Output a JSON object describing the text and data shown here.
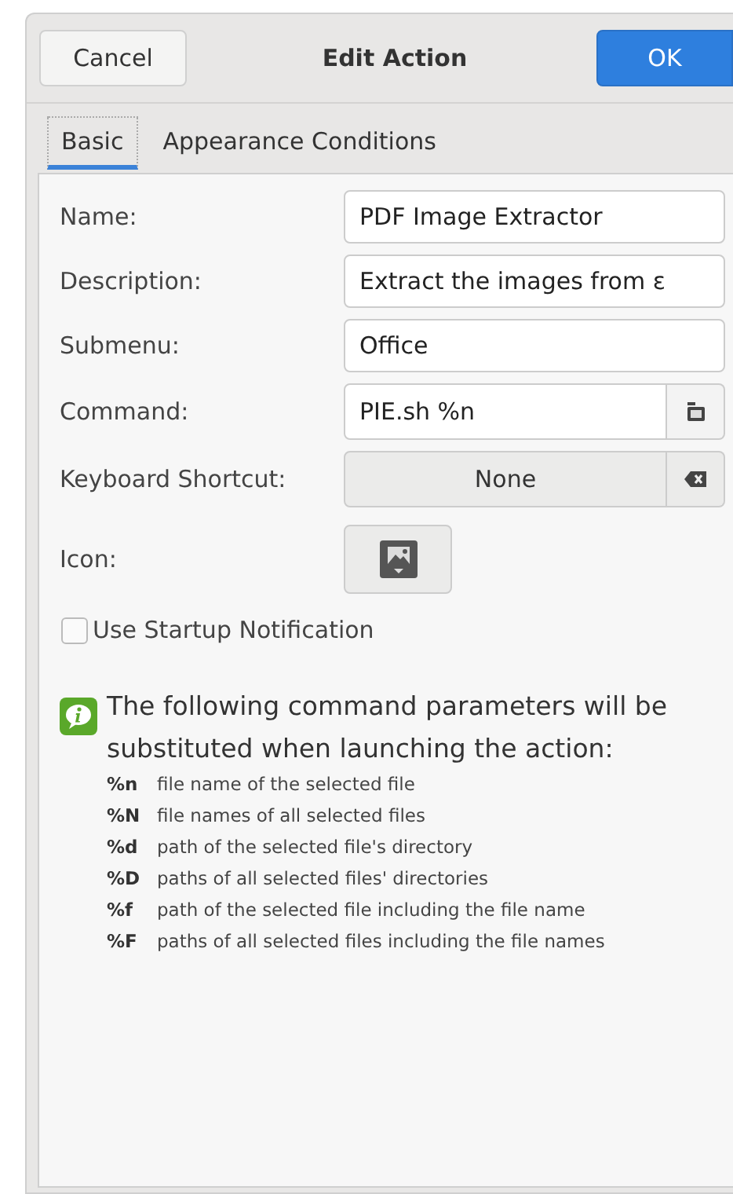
{
  "window": {
    "title": "Edit Action",
    "cancel_button": "Cancel",
    "ok_button": "OK"
  },
  "tabs": [
    {
      "label": "Basic",
      "selected": true
    },
    {
      "label": "Appearance Conditions",
      "selected": false
    }
  ],
  "fields": [
    {
      "label": "Name:",
      "kind": "text",
      "value": "PDF Image Extractor"
    },
    {
      "label": "Description:",
      "kind": "text",
      "value": "Extract the images from ε"
    },
    {
      "label": "Submenu:",
      "kind": "text",
      "value": "Office"
    },
    {
      "label": "Command:",
      "kind": "file",
      "value": "PIE.sh %n"
    },
    {
      "label": "Keyboard Shortcut:",
      "kind": "shortcut",
      "value": "None"
    },
    {
      "label": "Icon:",
      "kind": "icon"
    }
  ],
  "startup_notification": {
    "label": "Use Startup Notification",
    "checked": false
  },
  "info": {
    "text": "The following command parameters will be substituted when launching the action:",
    "parameters": [
      {
        "code": "%n",
        "description": "file name of the selected file"
      },
      {
        "code": "%N",
        "description": "file names of all selected files"
      },
      {
        "code": "%d",
        "description": "path of the selected file's directory"
      },
      {
        "code": "%D",
        "description": "paths of all selected files' directories"
      },
      {
        "code": "%f",
        "description": "path of the selected file including the file name"
      },
      {
        "code": "%F",
        "description": "paths of all selected files including the file names"
      }
    ]
  }
}
